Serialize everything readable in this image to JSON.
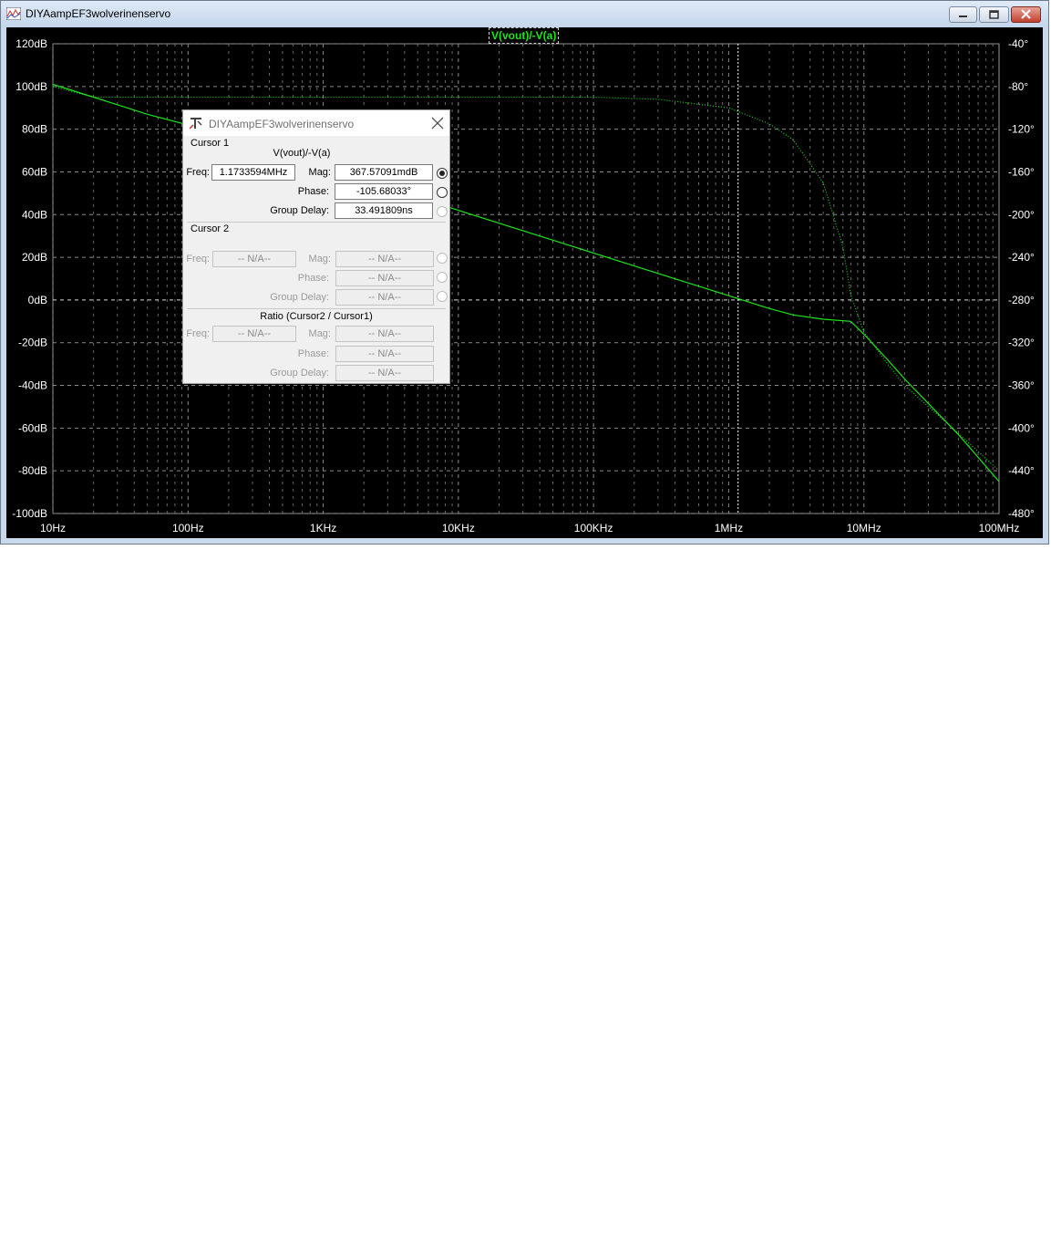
{
  "window": {
    "title": "DIYAampEF3wolverinenservo"
  },
  "plot": {
    "trace_label": "V(vout)/-V(a)",
    "trace_color": "#19e619",
    "background": "#000000"
  },
  "chart_data": {
    "type": "line",
    "title": "V(vout)/-V(a)",
    "x_scale": "log",
    "xlim": [
      10,
      100000000
    ],
    "x_ticks": [
      "10Hz",
      "100Hz",
      "1KHz",
      "10KHz",
      "100KHz",
      "1MHz",
      "10MHz",
      "100MHz"
    ],
    "ylim_left": [
      -100,
      120
    ],
    "y_ticks_left": [
      "120dB",
      "100dB",
      "80dB",
      "60dB",
      "40dB",
      "20dB",
      "0dB",
      "-20dB",
      "-40dB",
      "-60dB",
      "-80dB",
      "-100dB"
    ],
    "ylim_right": [
      -480,
      -40
    ],
    "y_ticks_right": [
      "-40°",
      "-80°",
      "-120°",
      "-160°",
      "-200°",
      "-240°",
      "-280°",
      "-320°",
      "-360°",
      "-400°",
      "-440°",
      "-480°"
    ],
    "grid": true,
    "series": [
      {
        "style": "solid",
        "axis": "left",
        "x": [
          10,
          20,
          50,
          100,
          200,
          1000,
          10000,
          100000,
          1000000,
          2000000,
          3000000,
          5000000,
          8000000,
          10000000,
          15000000,
          20000000,
          50000000,
          100000000
        ],
        "y": [
          101,
          95,
          87,
          82,
          76,
          62,
          42,
          22,
          2,
          -4,
          -7,
          -9,
          -10,
          -16,
          -28,
          -37,
          -63,
          -85
        ]
      },
      {
        "style": "dotted",
        "axis": "right",
        "x": [
          10,
          20,
          100,
          1000,
          10000,
          100000,
          300000,
          1000000,
          2000000,
          3000000,
          5000000,
          7000000,
          8000000,
          10000000,
          15000000,
          20000000,
          50000000,
          100000000
        ],
        "y": [
          -80,
          -90,
          -90,
          -90,
          -90,
          -90,
          -92,
          -100,
          -115,
          -130,
          -170,
          -230,
          -275,
          -310,
          -340,
          -360,
          -405,
          -440
        ]
      }
    ]
  },
  "dialog": {
    "title": "DIYAampEF3wolverinenservo",
    "cursor1": {
      "heading": "Cursor 1",
      "trace": "V(vout)/-V(a)",
      "freq_label": "Freq:",
      "freq_value": "1.1733594MHz",
      "mag_label": "Mag:",
      "mag_value": "367.57091mdB",
      "phase_label": "Phase:",
      "phase_value": "-105.68033°",
      "gd_label": "Group Delay:",
      "gd_value": "33.491809ns"
    },
    "cursor2": {
      "heading": "Cursor 2",
      "freq_label": "Freq:",
      "freq_value": "-- N/A--",
      "mag_label": "Mag:",
      "mag_value": "-- N/A--",
      "phase_label": "Phase:",
      "phase_value": "-- N/A--",
      "gd_label": "Group Delay:",
      "gd_value": "-- N/A--"
    },
    "ratio": {
      "heading": "Ratio (Cursor2 / Cursor1)",
      "freq_label": "Freq:",
      "freq_value": "-- N/A--",
      "mag_label": "Mag:",
      "mag_value": "-- N/A--",
      "phase_label": "Phase:",
      "phase_value": "-- N/A--",
      "gd_label": "Group Delay:",
      "gd_value": "-- N/A--"
    }
  }
}
